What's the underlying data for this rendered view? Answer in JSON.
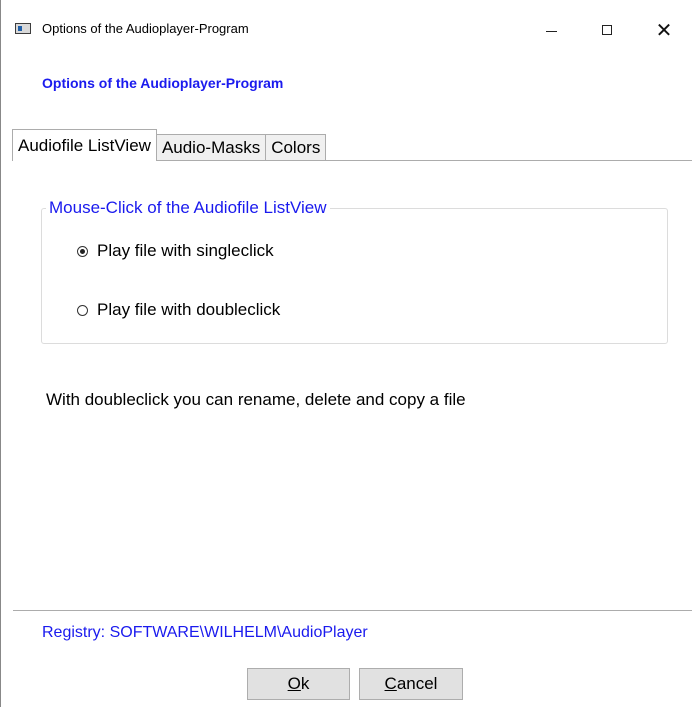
{
  "window": {
    "title": "Options of the Audioplayer-Program",
    "minimize_glyph": "minimize",
    "maximize_glyph": "maximize",
    "close_glyph": "✕"
  },
  "header": {
    "label": "Options of the Audioplayer-Program"
  },
  "tabs": [
    {
      "label": "Audiofile ListView",
      "selected": true
    },
    {
      "label": "Audio-Masks",
      "selected": false
    },
    {
      "label": "Colors",
      "selected": false
    }
  ],
  "mouse_click_group": {
    "legend": "Mouse-Click of the Audiofile ListView",
    "options": [
      {
        "label": "Play file with singleclick",
        "checked": true
      },
      {
        "label": "Play file with doubleclick",
        "checked": false
      }
    ]
  },
  "info_text": "With doubleclick you can rename, delete and copy a file",
  "registry": "Registry: SOFTWARE\\WILHELM\\AudioPlayer",
  "buttons": {
    "ok_mnemonic": "O",
    "ok_rest": "k",
    "cancel_mnemonic": "C",
    "cancel_rest": "ancel"
  },
  "colors": {
    "accent_blue": "#1a1aee",
    "button_face": "#e1e1e1"
  }
}
